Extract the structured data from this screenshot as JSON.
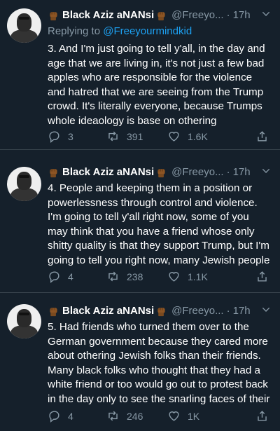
{
  "tweets": [
    {
      "display_name": "Black Aziz aNANsi",
      "handle": "@Freeyo...",
      "time": "17h",
      "reply_prefix": "Replying to",
      "reply_mention": "@Freeyourmindkid",
      "text": "3. And I'm just going to tell y'all, in the day and age that we are living in,  it's not just a few bad apples who are responsible for the violence and hatred that we are seeing from the Trump crowd. It's literally everyone, because Trumps whole ideaology is base on othering",
      "replies": "3",
      "retweets": "391",
      "likes": "1.6K"
    },
    {
      "display_name": "Black Aziz aNANsi",
      "handle": "@Freeyo...",
      "time": "17h",
      "text": "4. People and keeping them in a position or powerlessness through control and violence. I'm going to tell y'all right now, some of you may think that you have a friend whose only shitty quality is that they support Trump, but I'm going to tell you right now, many Jewish people",
      "replies": "4",
      "retweets": "238",
      "likes": "1.1K"
    },
    {
      "display_name": "Black Aziz aNANsi",
      "handle": "@Freeyo...",
      "time": "17h",
      "text": "5. Had friends who turned them over to the German government because they cared more about othering Jewish folks than their friends. Many black folks who thought that they had a white friend or too would go out to protest back in the day only to see the snarling faces of their",
      "replies": "4",
      "retweets": "246",
      "likes": "1K"
    }
  ],
  "icons": {
    "reply": "reply-icon",
    "retweet": "retweet-icon",
    "like": "heart-icon",
    "share": "share-icon",
    "caret": "chevron-down-icon",
    "emoji": "raised-fist-emoji"
  },
  "colors": {
    "background": "#15202b",
    "secondary_text": "#8899a6",
    "link": "#1da1f2",
    "divider": "#38444d"
  }
}
